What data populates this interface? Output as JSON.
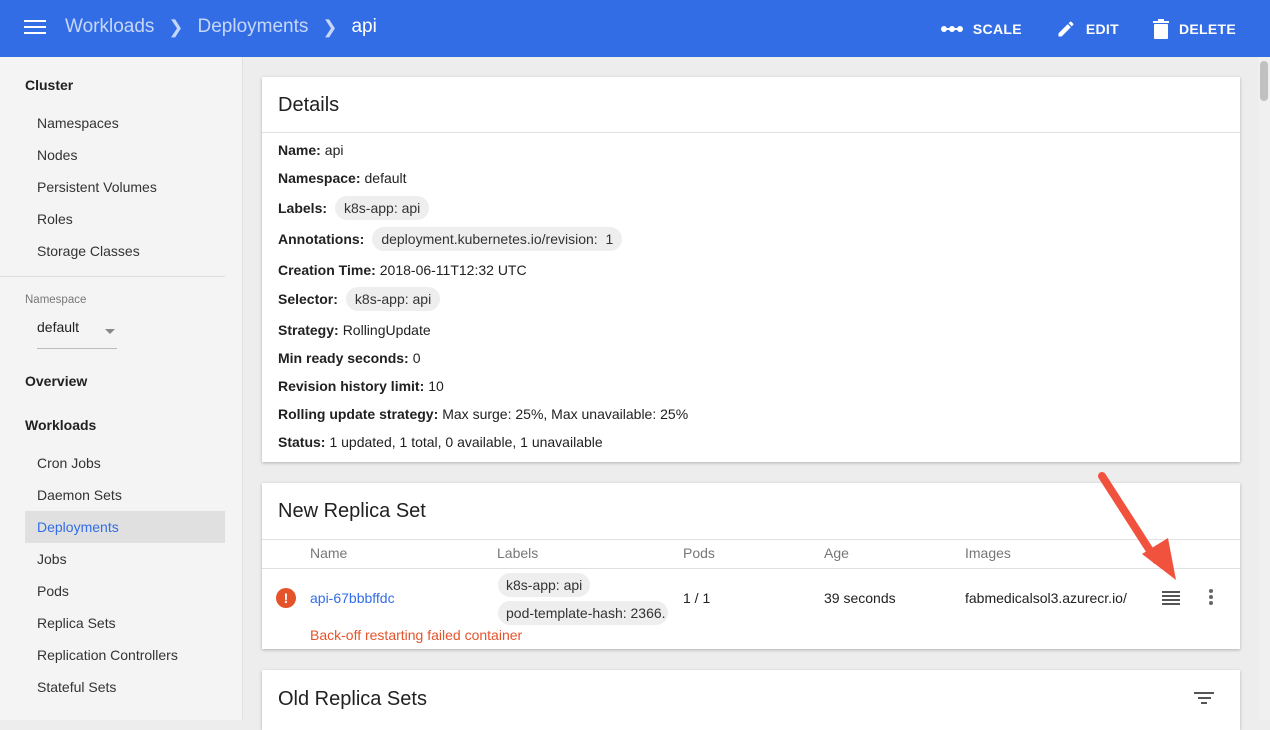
{
  "header": {
    "breadcrumbs": [
      "Workloads",
      "Deployments",
      "api"
    ],
    "actions": [
      {
        "label": "SCALE",
        "icon": "scale-icon"
      },
      {
        "label": "EDIT",
        "icon": "pencil-icon"
      },
      {
        "label": "DELETE",
        "icon": "trash-icon"
      }
    ]
  },
  "sidebar": {
    "cluster_heading": "Cluster",
    "cluster_items": [
      "Namespaces",
      "Nodes",
      "Persistent Volumes",
      "Roles",
      "Storage Classes"
    ],
    "namespace_label": "Namespace",
    "namespace_value": "default",
    "overview": "Overview",
    "workloads_heading": "Workloads",
    "workload_items": [
      "Cron Jobs",
      "Daemon Sets",
      "Deployments",
      "Jobs",
      "Pods",
      "Replica Sets",
      "Replication Controllers",
      "Stateful Sets"
    ],
    "active_item": "Deployments"
  },
  "details": {
    "title": "Details",
    "name_label": "Name:",
    "name": "api",
    "namespace_label": "Namespace:",
    "namespace": "default",
    "labels_label": "Labels:",
    "labels": "k8s-app: api",
    "annotations_label": "Annotations:",
    "annotations": "deployment.kubernetes.io/revision:  1",
    "creation_label": "Creation Time:",
    "creation": "2018-06-11T12:32 UTC",
    "selector_label": "Selector:",
    "selector": "k8s-app: api",
    "strategy_label": "Strategy:",
    "strategy": "RollingUpdate",
    "min_ready_label": "Min ready seconds:",
    "min_ready": "0",
    "revision_label": "Revision history limit:",
    "revision": "10",
    "rolling_label": "Rolling update strategy:",
    "rolling": "Max surge: 25%, Max unavailable: 25%",
    "status_label": "Status:",
    "status": "1 updated, 1 total, 0 available, 1 unavailable"
  },
  "new_replica_set": {
    "title": "New Replica Set",
    "columns": [
      "Name",
      "Labels",
      "Pods",
      "Age",
      "Images"
    ],
    "row": {
      "name": "api-67bbbffdc",
      "labels": [
        "k8s-app: api",
        "pod-template-hash: 2366."
      ],
      "pods": "1 / 1",
      "age": "39 seconds",
      "image": "fabmedicalsol3.azurecr.io/",
      "error": "Back-off restarting failed container"
    }
  },
  "old_replica_sets": {
    "title": "Old Replica Sets"
  },
  "colors": {
    "topbar": "#326de6",
    "link": "#326de6",
    "error": "#e5532b",
    "annotation_arrow": "#f0523e"
  }
}
